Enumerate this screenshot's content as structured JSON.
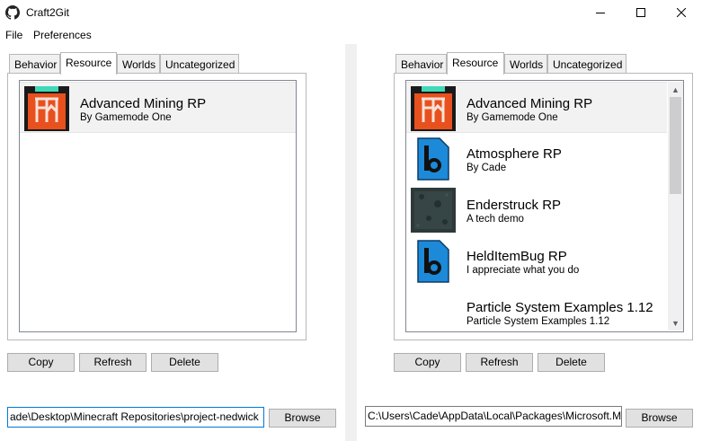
{
  "window": {
    "title": "Craft2Git"
  },
  "menu": {
    "items": [
      "File",
      "Preferences"
    ]
  },
  "left": {
    "tabs": [
      "Behavior",
      "Resource",
      "Worlds",
      "Uncategorized"
    ],
    "active_tab": "Resource",
    "items": [
      {
        "title": "Advanced Mining RP",
        "subtitle": "By Gamemode One",
        "icon": "advanced-mining-icon"
      }
    ],
    "buttons": {
      "copy": "Copy",
      "refresh": "Refresh",
      "delete": "Delete"
    },
    "path": "ade\\Desktop\\Minecraft Repositories\\project-nedwick",
    "browse": "Browse"
  },
  "right": {
    "tabs": [
      "Behavior",
      "Resource",
      "Worlds",
      "Uncategorized"
    ],
    "active_tab": "Resource",
    "items": [
      {
        "title": "Advanced Mining RP",
        "subtitle": "By Gamemode One",
        "icon": "advanced-mining-icon"
      },
      {
        "title": "Atmosphere RP",
        "subtitle": "By Cade",
        "icon": "pack-blue-icon"
      },
      {
        "title": "Enderstruck RP",
        "subtitle": "A tech demo",
        "icon": "enderstruck-icon"
      },
      {
        "title": "HeldItemBug RP",
        "subtitle": "I appreciate what you do",
        "icon": "pack-blue-icon"
      },
      {
        "title": "Particle System Examples 1.12",
        "subtitle": "Particle System Examples 1.12",
        "icon": "none"
      }
    ],
    "buttons": {
      "copy": "Copy",
      "refresh": "Refresh",
      "delete": "Delete"
    },
    "path": "C:\\Users\\Cade\\AppData\\Local\\Packages\\Microsoft.Mi",
    "browse": "Browse"
  },
  "colors": {
    "accent": "#0078d7",
    "orange": "#e8501e",
    "pack_blue": "#1c8ad8",
    "teal": "#3fd9b8"
  }
}
